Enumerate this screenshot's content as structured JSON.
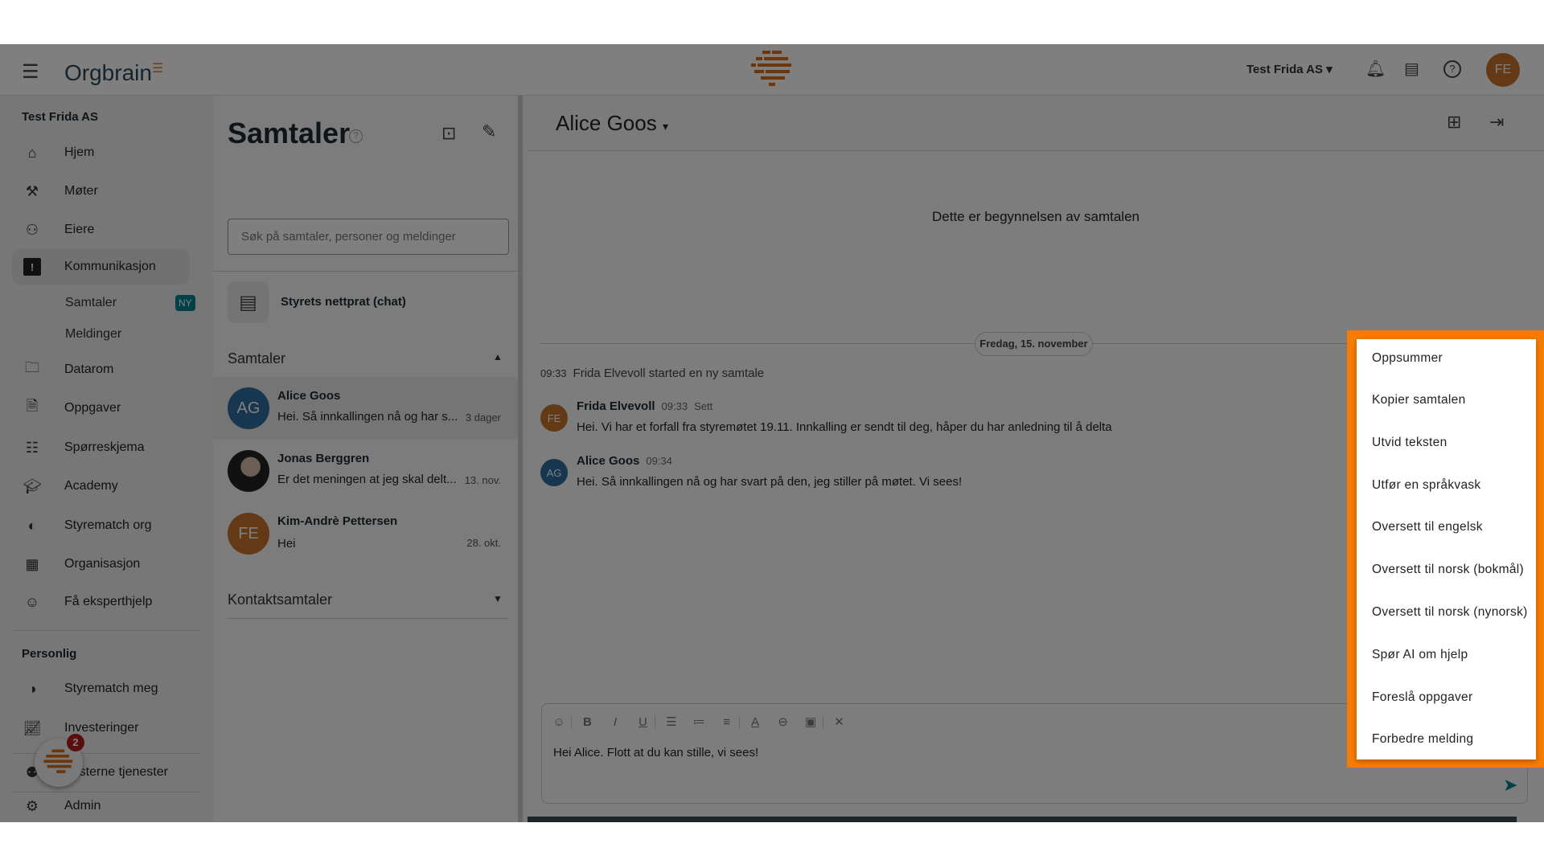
{
  "topbar": {
    "logo_text": "Orgbrain",
    "org_selector": "Test Frida AS",
    "user_initials": "FE",
    "icons": [
      "menu-icon",
      "bell-icon",
      "chat-icon",
      "help-icon"
    ]
  },
  "sidebar": {
    "org_title": "Test Frida AS",
    "items": [
      {
        "label": "Hjem",
        "icon": "home-icon"
      },
      {
        "label": "Møter",
        "icon": "gavel-icon"
      },
      {
        "label": "Eiere",
        "icon": "people-icon"
      },
      {
        "label": "Kommunikasjon",
        "icon": "feedback-icon"
      },
      {
        "label": "Datarom",
        "icon": "folder-icon"
      },
      {
        "label": "Oppgaver",
        "icon": "task-icon"
      },
      {
        "label": "Spørreskjema",
        "icon": "survey-icon"
      },
      {
        "label": "Academy",
        "icon": "school-icon"
      },
      {
        "label": "Styrematch org",
        "icon": "match-icon"
      },
      {
        "label": "Organisasjon",
        "icon": "building-icon"
      },
      {
        "label": "Få eksperthjelp",
        "icon": "expert-icon"
      }
    ],
    "subitems": [
      {
        "label": "Samtaler",
        "badge": "NY"
      },
      {
        "label": "Meldinger"
      }
    ],
    "personal_title": "Personlig",
    "personal_items": [
      {
        "label": "Styrematch meg",
        "icon": "match-icon"
      },
      {
        "label": "Investeringer",
        "icon": "chart-icon"
      }
    ],
    "external": "Eksterne tjenester",
    "admin": "Admin",
    "chatbot_badge": "2"
  },
  "conversations": {
    "title": "Samtaler",
    "search_placeholder": "Søk på samtaler, personer og meldinger",
    "board_chat": "Styrets nettprat (chat)",
    "section_title": "Samtaler",
    "items": [
      {
        "initials": "AG",
        "name": "Alice Goos",
        "preview": "Hei. Så innkallingen nå og har s...",
        "time": "3 dager",
        "color": "#2c6e9e"
      },
      {
        "initials": "",
        "name": "Jonas Berggren",
        "preview": "Er det meningen at jeg skal delt...",
        "time": "13. nov.",
        "color": "#333333"
      },
      {
        "initials": "FE",
        "name": "Kim-Andrè Pettersen",
        "preview": "Hei",
        "time": "28. okt.",
        "color": "#c8732c"
      }
    ],
    "contacts_title": "Kontaktsamtaler"
  },
  "chat": {
    "title": "Alice Goos",
    "start_text": "Dette er begynnelsen av samtalen",
    "date": "Fredag, 15. november",
    "system": {
      "time": "09:33",
      "text": "Frida Elvevoll started en ny samtale"
    },
    "messages": [
      {
        "initials": "FE",
        "name": "Frida Elvevoll",
        "time": "09:33",
        "status": "Sett",
        "text": "Hei. Vi har et forfall fra styremøtet 19.11. Innkalling er sendt til deg, håper du har anledning til å delta",
        "color": "#c8732c"
      },
      {
        "initials": "AG",
        "name": "Alice Goos",
        "time": "09:34",
        "status": "",
        "text": "Hei. Så innkallingen nå og har svart på den, jeg stiller på møtet. Vi sees!",
        "color": "#2c6e9e"
      }
    ],
    "composer_text": "Hei Alice. Flott at du kan stille, vi sees!"
  },
  "ai_menu": {
    "border_color": "#f57c00",
    "items": [
      "Oppsummer",
      "Kopier samtalen",
      "Utvid teksten",
      "Utfør en språkvask",
      "Oversett til engelsk",
      "Oversett til norsk (bokmål)",
      "Oversett til norsk (nynorsk)",
      "Spør AI om hjelp",
      "Foreslå oppgaver",
      "Forbedre melding"
    ]
  }
}
